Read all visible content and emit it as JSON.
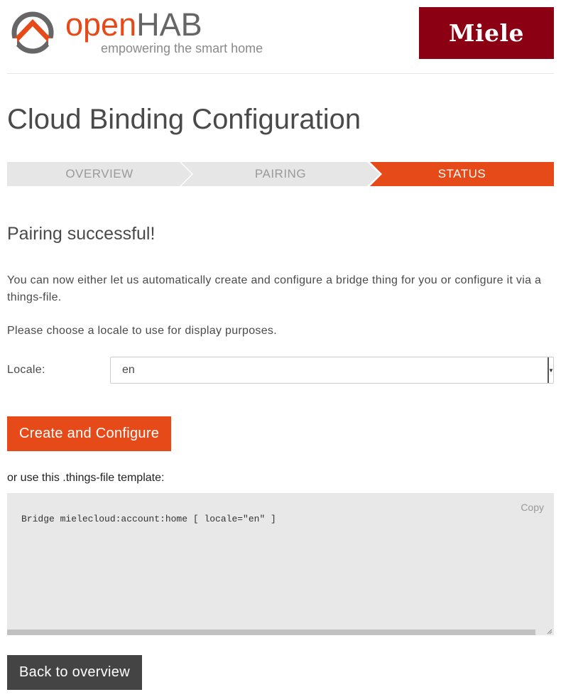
{
  "header": {
    "brand_open": "open",
    "brand_hab": "HAB",
    "tagline": "empowering the smart home",
    "partner_logo": "Miele"
  },
  "page": {
    "title": "Cloud Binding Configuration"
  },
  "steps": [
    {
      "label": "OVERVIEW",
      "active": false
    },
    {
      "label": "PAIRING",
      "active": false
    },
    {
      "label": "STATUS",
      "active": true
    }
  ],
  "main": {
    "heading": "Pairing successful!",
    "intro": "You can now either let us automatically create and configure a bridge thing for you or configure it via a things-file.",
    "locale_hint": "Please choose a locale to use for display purposes.",
    "locale_label": "Locale:",
    "locale_value": "en",
    "create_button": "Create and Configure",
    "template_label": "or use this .things-file template:",
    "template_code": "Bridge mielecloud:account:home [ locale=\"en\" ]",
    "copy_label": "Copy",
    "back_button": "Back to overview"
  },
  "colors": {
    "accent": "#e64a19",
    "miele_red": "#8c0014",
    "step_inactive": "#e6e6e6",
    "back_button": "#444444"
  }
}
